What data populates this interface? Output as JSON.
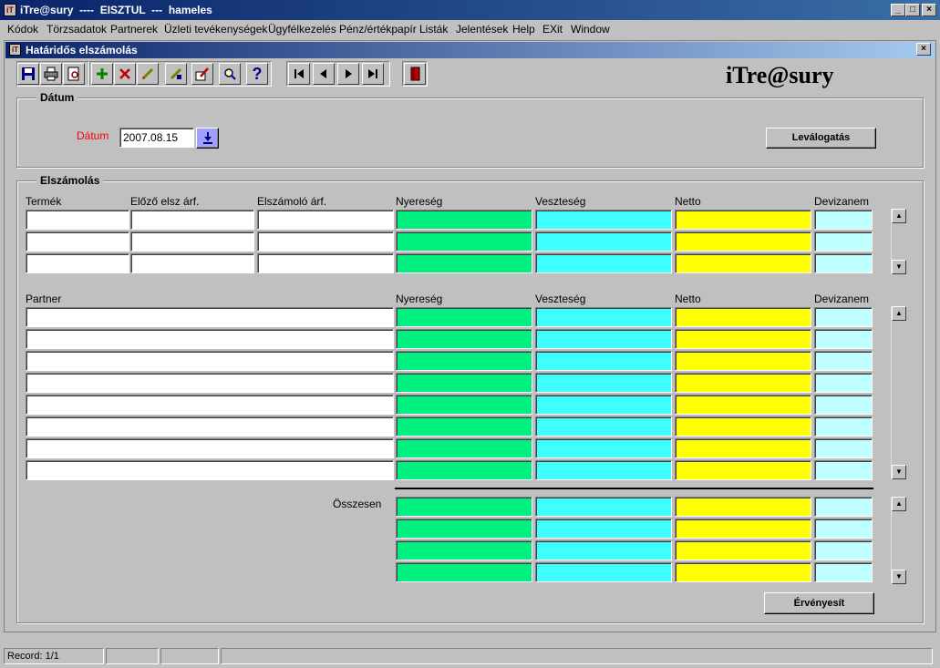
{
  "window": {
    "title": "iTre@sury  ----  EISZTUL  ---  hameles",
    "icon": "app-icon",
    "controls": [
      "_",
      "□",
      "×"
    ]
  },
  "menu": [
    {
      "label": "Kódok"
    },
    {
      "label": "Törzsadatok"
    },
    {
      "label": "Partnerek"
    },
    {
      "label": "Üzleti tevékenységek"
    },
    {
      "label": "Ügyfélkezelés"
    },
    {
      "label": "Pénz/értékpapír"
    },
    {
      "label": "Listák"
    },
    {
      "label": "Jelentések"
    },
    {
      "label": "Help"
    },
    {
      "label": "EXit"
    },
    {
      "label": "Window"
    }
  ],
  "child": {
    "title": "Határidős elszámolás",
    "close": "×"
  },
  "toolbar": {
    "icons": [
      "save-icon",
      "print-icon",
      "print-preview-icon",
      "insert-record-icon",
      "delete-record-icon",
      "clear-icon",
      "query-icon",
      "edit-icon",
      "search-icon",
      "help-icon",
      "first-record-icon",
      "previous-record-icon",
      "next-record-icon",
      "last-record-icon",
      "exit-icon"
    ],
    "help_glyph": "?"
  },
  "brand": "iTre@sury",
  "datum_section": {
    "title": "Dátum",
    "label": "Dátum",
    "value": "2007.08.15",
    "label_color": "#ff0000",
    "filter_button": "Leválogatás"
  },
  "elszamolas": {
    "title": "Elszámolás",
    "product_headers": [
      "Termék",
      "Előző elsz árf.",
      "Elszámoló árf.",
      "Nyereség",
      "Veszteség",
      "Netto",
      "Devizanem"
    ],
    "partner_headers": [
      "Partner",
      "Nyereség",
      "Veszteség",
      "Netto",
      "Devizanem"
    ],
    "total_label": "Összesen",
    "submit_button": "Érvényesít"
  },
  "colors": {
    "profit": "#00f080",
    "loss": "#40ffff",
    "net": "#ffff00",
    "currency": "#c0ffff"
  },
  "status": {
    "record": "Record: 1/1"
  }
}
